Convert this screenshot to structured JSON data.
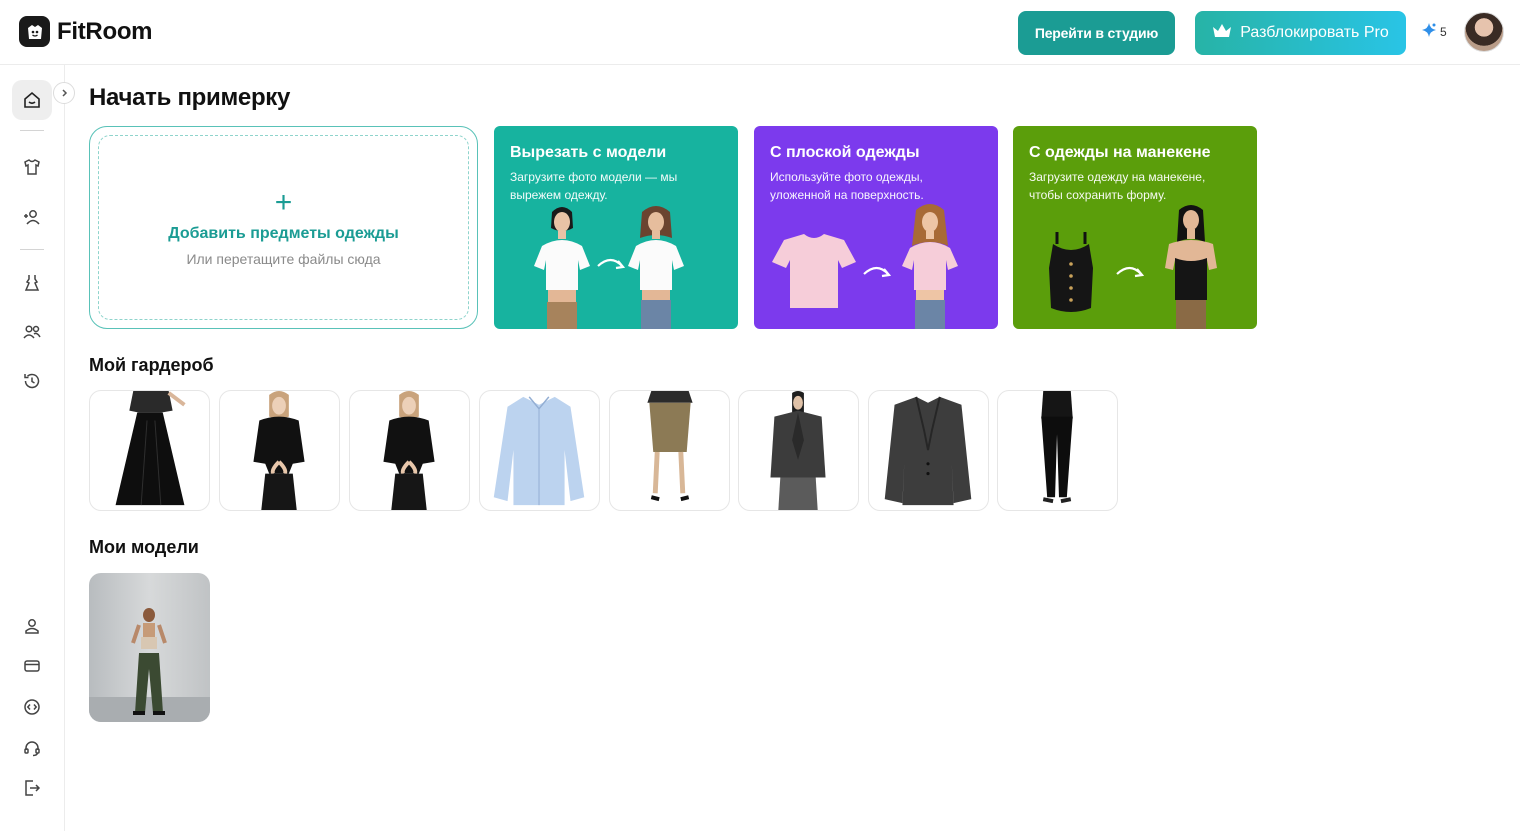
{
  "header": {
    "logo_text": "FitRoom",
    "studio_button": "Перейти в студию",
    "pro_button": "Разблокировать Pro",
    "credits": "5",
    "icons": {
      "logo": "fitroom-logo-icon",
      "crown": "crown-icon",
      "credits": "sparkle-icon",
      "avatar": "user-avatar"
    }
  },
  "sidebar": {
    "items": [
      {
        "name": "home",
        "icon": "home-smile-icon",
        "active": true
      },
      {
        "name": "wardrobe",
        "icon": "tshirt-icon"
      },
      {
        "name": "add-model",
        "icon": "user-plus-icon"
      },
      {
        "name": "outfits",
        "icon": "dress-icon"
      },
      {
        "name": "models",
        "icon": "users-icon"
      },
      {
        "name": "history",
        "icon": "history-icon"
      }
    ],
    "bottom": [
      {
        "name": "profile",
        "icon": "user-icon"
      },
      {
        "name": "billing",
        "icon": "credit-card-icon"
      },
      {
        "name": "api",
        "icon": "code-circle-icon"
      },
      {
        "name": "support",
        "icon": "headset-icon"
      },
      {
        "name": "logout",
        "icon": "logout-icon"
      }
    ]
  },
  "main": {
    "title": "Начать примерку",
    "upload": {
      "title": "Добавить предметы одежды",
      "subtitle": "Или перетащите файлы сюда"
    },
    "modes": [
      {
        "title": "Вырезать с модели",
        "desc": "Загрузите фото модели — мы вырежем одежду.",
        "color": "#17b39f"
      },
      {
        "title": "С плоской одежды",
        "desc": "Используйте фото одежды, уложенной на поверхность.",
        "color": "#7c3aed"
      },
      {
        "title": "С одежды на манекене",
        "desc": "Загрузите одежду на манекене, чтобы сохранить форму.",
        "color": "#5b9e0b"
      }
    ],
    "wardrobe_title": "Мой гардероб",
    "wardrobe_items": [
      "black-maxi-skirt",
      "black-cropped-jacket",
      "black-cropped-jacket",
      "light-blue-shirt",
      "khaki-midi-skirt",
      "grey-oversized-blazer",
      "charcoal-blazer",
      "black-leggings"
    ],
    "models_title": "Мои модели"
  }
}
